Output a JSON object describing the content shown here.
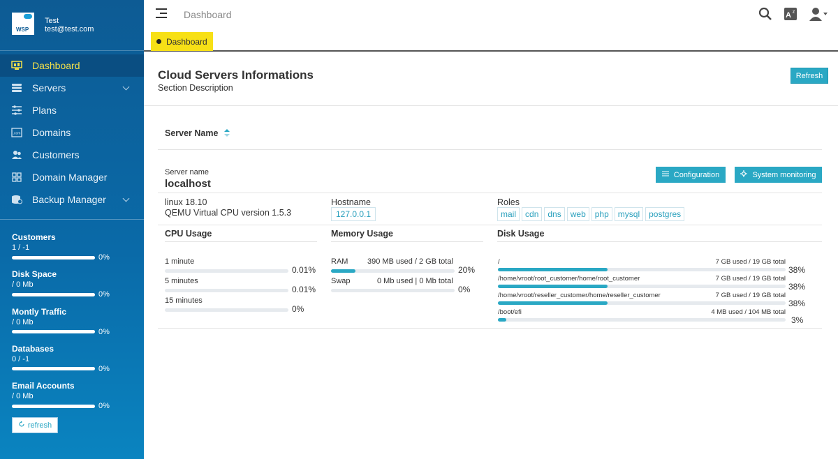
{
  "user": {
    "logo_text": "WSP",
    "name": "Test",
    "email": "test@test.com"
  },
  "nav": [
    {
      "label": "Dashboard",
      "icon": "monitor-icon",
      "active": true
    },
    {
      "label": "Servers",
      "icon": "servers-icon",
      "expandable": true
    },
    {
      "label": "Plans",
      "icon": "sliders-icon"
    },
    {
      "label": "Domains",
      "icon": "domain-icon"
    },
    {
      "label": "Customers",
      "icon": "customers-icon"
    },
    {
      "label": "Domain Manager",
      "icon": "grid-icon"
    },
    {
      "label": "Backup Manager",
      "icon": "backup-icon",
      "expandable": true
    }
  ],
  "stats": [
    {
      "title": "Customers",
      "value": "1 / -1",
      "percent": "0%"
    },
    {
      "title": "Disk Space",
      "value": "/ 0 Mb",
      "percent": "0%"
    },
    {
      "title": "Montly Traffic",
      "value": "/ 0 Mb",
      "percent": "0%"
    },
    {
      "title": "Databases",
      "value": "0 / -1",
      "percent": "0%"
    },
    {
      "title": "Email Accounts",
      "value": "/ 0 Mb",
      "percent": "0%"
    }
  ],
  "sidebar_refresh_label": "refresh",
  "topbar": {
    "title": "Dashboard",
    "tab_label": "Dashboard"
  },
  "panel": {
    "title": "Cloud Servers Informations",
    "description": "Section Description",
    "refresh_label": "Refresh"
  },
  "table": {
    "header": "Server Name"
  },
  "server": {
    "name_label": "Server name",
    "name": "localhost",
    "config_label": "Configuration",
    "monitor_label": "System monitoring",
    "os": "linux 18.10",
    "cpu_model": "QEMU Virtual CPU version 1.5.3",
    "hostname_label": "Hostname",
    "hostname": "127.0.0.1",
    "roles_label": "Roles",
    "roles": [
      "mail",
      "cdn",
      "dns",
      "web",
      "php",
      "mysql",
      "postgres"
    ]
  },
  "cpu": {
    "title": "CPU Usage",
    "rows": [
      {
        "label": "1 minute",
        "percent": "0.01%",
        "fraction": 0.0001
      },
      {
        "label": "5 minutes",
        "percent": "0.01%",
        "fraction": 0.0001
      },
      {
        "label": "15 minutes",
        "percent": "0%",
        "fraction": 0
      }
    ]
  },
  "memory": {
    "title": "Memory Usage",
    "rows": [
      {
        "label": "RAM",
        "detail": "390 MB used / 2 GB total",
        "percent": "20%",
        "fraction": 0.2
      },
      {
        "label": "Swap",
        "detail": "0 Mb used | 0 Mb total",
        "percent": "0%",
        "fraction": 0
      }
    ]
  },
  "disk": {
    "title": "Disk Usage",
    "rows": [
      {
        "path": "/",
        "detail": "7 GB used / 19 GB total",
        "percent": "38%",
        "fraction": 0.38
      },
      {
        "path": "/home/vroot/root_customer/home/root_customer",
        "detail": "7 GB used / 19 GB total",
        "percent": "38%",
        "fraction": 0.38
      },
      {
        "path": "/home/vroot/reseller_customer/home/reseller_customer",
        "detail": "7 GB used / 19 GB total",
        "percent": "38%",
        "fraction": 0.38
      },
      {
        "path": "/boot/efi",
        "detail": "4 MB used / 104 MB total",
        "percent": "3%",
        "fraction": 0.03
      }
    ]
  },
  "colors": {
    "accent": "#2aa8c4",
    "tab_highlight": "#f7e016",
    "active_nav_text": "#f3e04a"
  }
}
